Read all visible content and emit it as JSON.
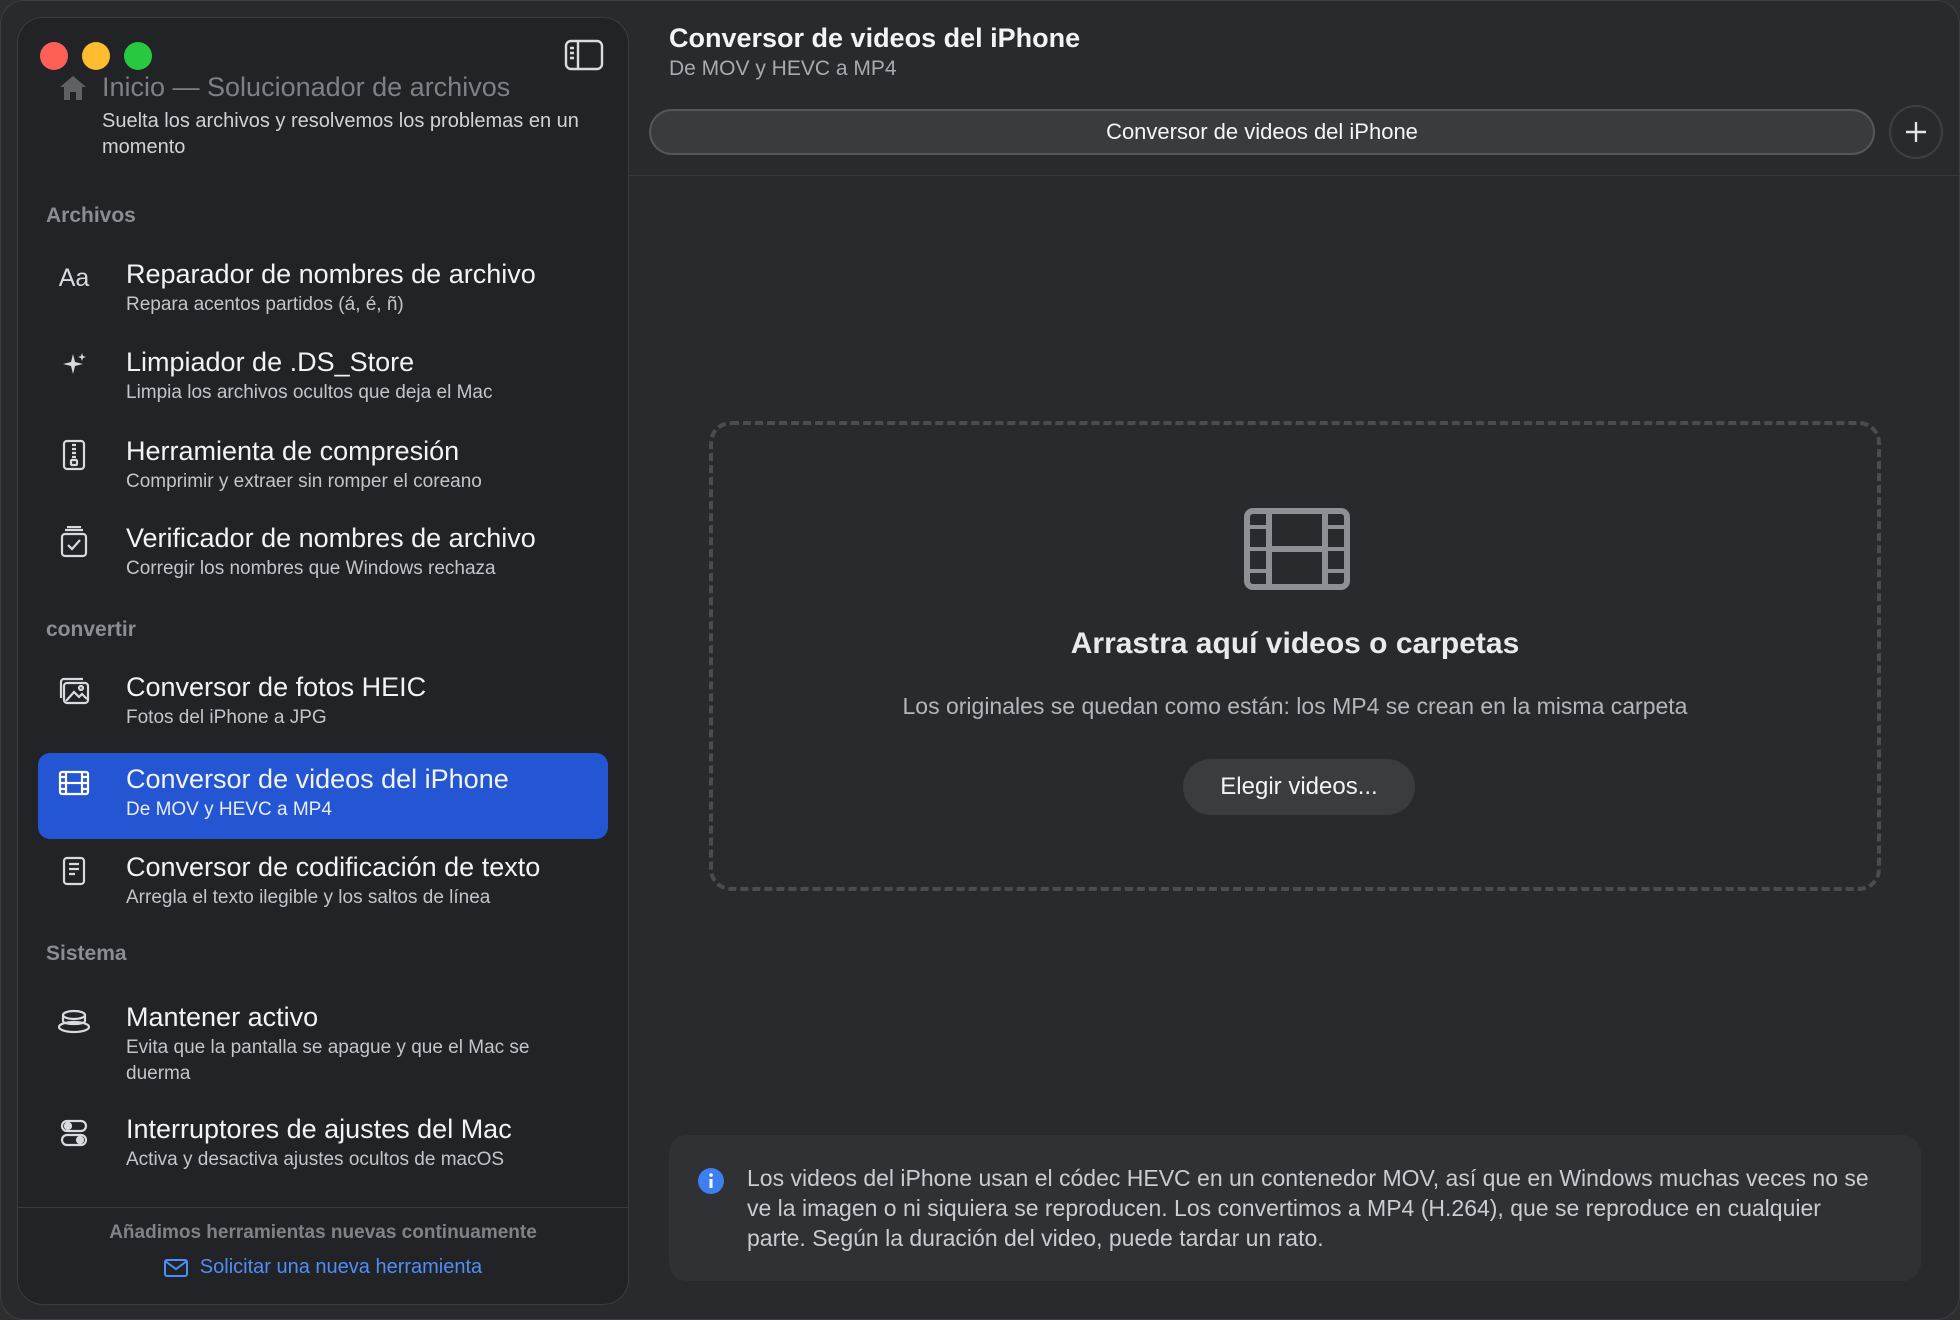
{
  "sidebar": {
    "home": {
      "title": "Inicio — Solucionador de archivos",
      "subtitle": "Suelta los archivos y resolvemos los problemas en un momento"
    },
    "sections": [
      {
        "label": "Archivos",
        "items": [
          {
            "title": "Reparador de nombres de archivo",
            "subtitle": "Repara acentos partidos (á, é, ñ)",
            "icon": "text-format-icon"
          },
          {
            "title": "Limpiador de .DS_Store",
            "subtitle": "Limpia los archivos ocultos que deja el Mac",
            "icon": "sparkles-icon"
          },
          {
            "title": "Herramienta de compresión",
            "subtitle": "Comprimir y extraer sin romper el coreano",
            "icon": "zipper-icon"
          },
          {
            "title": "Verificador de nombres de archivo",
            "subtitle": "Corregir los nombres que Windows rechaza",
            "icon": "checkmark-document-icon"
          }
        ]
      },
      {
        "label": "convertir",
        "items": [
          {
            "title": "Conversor de fotos HEIC",
            "subtitle": "Fotos del iPhone a JPG",
            "icon": "photos-icon"
          },
          {
            "title": "Conversor de videos del iPhone",
            "subtitle": "De MOV y HEVC a MP4",
            "icon": "film-icon",
            "active": true
          },
          {
            "title": "Conversor de codificación de texto",
            "subtitle": "Arregla el texto ilegible y los saltos de línea",
            "icon": "document-icon"
          }
        ]
      },
      {
        "label": "Sistema",
        "items": [
          {
            "title": "Mantener activo",
            "subtitle": "Evita que la pantalla se apague y que el Mac se duerma",
            "icon": "coffee-cup-icon"
          },
          {
            "title": "Interruptores de ajustes del Mac",
            "subtitle": "Activa y desactiva ajustes ocultos de macOS",
            "icon": "toggles-icon"
          }
        ]
      }
    ],
    "footer": {
      "note": "Añadimos herramientas nuevas continuamente",
      "link": "Solicitar una nueva herramienta"
    }
  },
  "main": {
    "title": "Conversor de videos del iPhone",
    "subtitle": "De MOV y HEVC a MP4",
    "tab_label": "Conversor de videos del iPhone",
    "dropzone": {
      "title": "Arrastra aquí videos o carpetas",
      "subtitle": "Los originales se quedan como están: los MP4 se crean en la misma carpeta",
      "button": "Elegir videos..."
    },
    "info": "Los videos del iPhone usan el códec HEVC en un contenedor MOV, así que en Windows muchas veces no se ve la imagen o ni siquiera se reproducen. Los convertimos a MP4 (H.264), que se reproduce en cualquier parte. Según la duración del video, puede tardar un rato."
  },
  "colors": {
    "accent": "#2456d4",
    "link": "#4f8ef7",
    "close": "#fe5f57",
    "minimize": "#febc2e",
    "zoom": "#28c840"
  }
}
